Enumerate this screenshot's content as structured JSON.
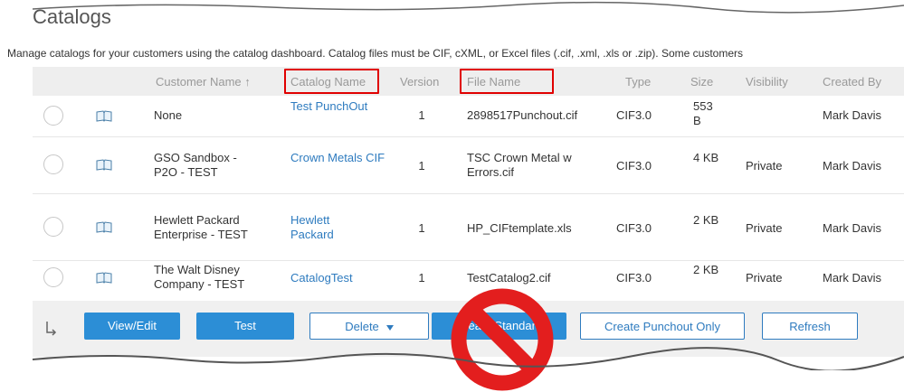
{
  "page": {
    "title": "Catalogs",
    "subtitle": "Manage catalogs for your customers using the catalog dashboard. Catalog files must be CIF, cXML, or Excel files (.cif, .xml, .xls or .zip). Some customers"
  },
  "table": {
    "columns": [
      "Customer Name ↑",
      "Catalog Name",
      "Version",
      "File Name",
      "Type",
      "Size",
      "Visibility",
      "Created By"
    ],
    "rows": [
      {
        "customer": "None",
        "catalog": "Test PunchOut",
        "version": "1",
        "file": "2898517Punchout.cif",
        "type": "CIF3.0",
        "size": "553 B",
        "visibility": "",
        "created_by": "Mark Davis"
      },
      {
        "customer": "GSO Sandbox - P2O - TEST",
        "catalog": "Crown Metals CIF",
        "version": "1",
        "file": "TSC Crown Metal w Errors.cif",
        "type": "CIF3.0",
        "size": "4 KB",
        "visibility": "Private",
        "created_by": "Mark Davis"
      },
      {
        "customer": "Hewlett Packard Enterprise - TEST",
        "catalog": "Hewlett Packard",
        "version": "1",
        "file": "HP_CIFtemplate.xls",
        "type": "CIF3.0",
        "size": "2 KB",
        "visibility": "Private",
        "created_by": "Mark Davis"
      },
      {
        "customer": "The Walt Disney Company - TEST",
        "catalog": "CatalogTest",
        "version": "1",
        "file": "TestCatalog2.cif",
        "type": "CIF3.0",
        "size": "2 KB",
        "visibility": "Private",
        "created_by": "Mark Davis"
      }
    ]
  },
  "buttons": {
    "view_edit": "View/Edit",
    "test": "Test",
    "delete": "Delete",
    "create_standard": "Create Standard",
    "create_punchout": "Create Punchout Only",
    "refresh": "Refresh"
  },
  "icons": {
    "row_icon": "catalog-book-icon",
    "footer_icon": "return-arrow-icon",
    "overlay": "prohibited-icon"
  },
  "colors": {
    "link": "#2e7bbf",
    "primary_button": "#2c8ed6",
    "highlight": "#e00000",
    "prohibited": "#e31e1e"
  }
}
